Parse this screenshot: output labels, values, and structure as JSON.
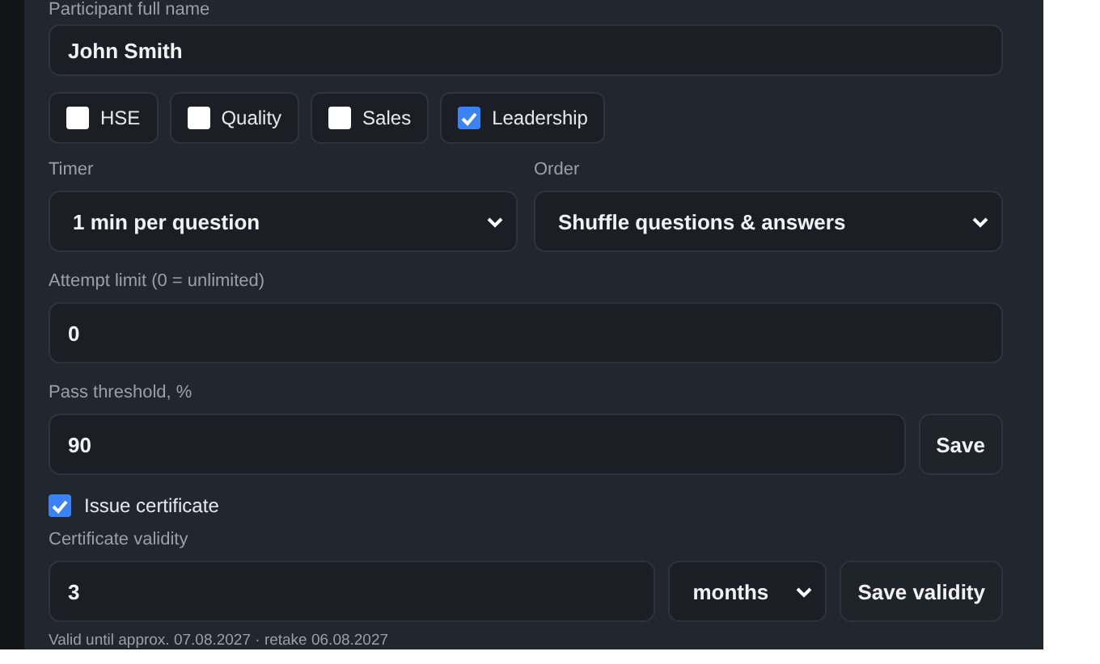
{
  "name_field": {
    "label": "Participant full name",
    "value": "John Smith"
  },
  "categories": [
    {
      "label": "HSE",
      "checked": false
    },
    {
      "label": "Quality",
      "checked": false
    },
    {
      "label": "Sales",
      "checked": false
    },
    {
      "label": "Leadership",
      "checked": true
    }
  ],
  "timer": {
    "label": "Timer",
    "value": "1 min per question"
  },
  "order": {
    "label": "Order",
    "value": "Shuffle questions & answers"
  },
  "attempt_limit": {
    "label": "Attempt limit (0 = unlimited)",
    "value": "0"
  },
  "pass_threshold": {
    "label": "Pass threshold, %",
    "value": "90",
    "button": "Save"
  },
  "issue_certificate": {
    "label": "Issue certificate",
    "checked": true
  },
  "certificate_validity": {
    "label": "Certificate validity",
    "value": "3",
    "unit": "months",
    "button": "Save validity",
    "note": "Valid until approx. 07.08.2027 · retake 06.08.2027"
  }
}
